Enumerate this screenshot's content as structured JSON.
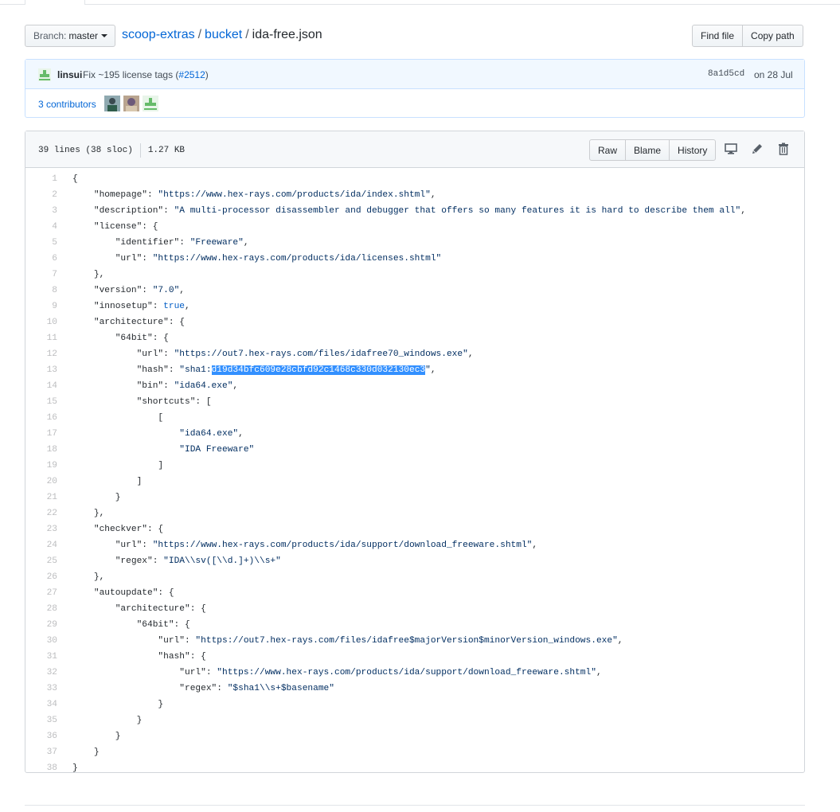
{
  "branch": {
    "prefix": "Branch:",
    "name": "master"
  },
  "breadcrumb": {
    "repo": "scoop-extras",
    "sep": "/",
    "folder": "bucket",
    "file": "ida-free.json"
  },
  "actions": {
    "find_file": "Find file",
    "copy_path": "Copy path"
  },
  "commit": {
    "author": "linsui",
    "message": "Fix ~195 license tags (",
    "pr": "#2512",
    "message_end": ")",
    "sha": "8a1d5cd",
    "date": "on 28 Jul"
  },
  "contributors": {
    "label": "3 contributors",
    "count": 3
  },
  "file": {
    "lines": "39 lines (38 sloc)",
    "size": "1.27 KB",
    "buttons": {
      "raw": "Raw",
      "blame": "Blame",
      "history": "History"
    },
    "icons": [
      "desktop-icon",
      "pencil-icon",
      "trash-icon"
    ]
  },
  "code": [
    "{",
    "    \"homepage\": \"https://www.hex-rays.com/products/ida/index.shtml\",",
    "    \"description\": \"A multi-processor disassembler and debugger that offers so many features it is hard to describe them all\",",
    "    \"license\": {",
    "        \"identifier\": \"Freeware\",",
    "        \"url\": \"https://www.hex-rays.com/products/ida/licenses.shtml\"",
    "    },",
    "    \"version\": \"7.0\",",
    "    \"innosetup\": true,",
    "    \"architecture\": {",
    "        \"64bit\": {",
    "            \"url\": \"https://out7.hex-rays.com/files/idafree70_windows.exe\",",
    "            \"hash\": \"sha1:d19d34bfc609e28cbfd92c1468c330d032130ec3\",",
    "            \"bin\": \"ida64.exe\",",
    "            \"shortcuts\": [",
    "                [",
    "                    \"ida64.exe\",",
    "                    \"IDA Freeware\"",
    "                ]",
    "            ]",
    "        }",
    "    },",
    "    \"checkver\": {",
    "        \"url\": \"https://www.hex-rays.com/products/ida/support/download_freeware.shtml\",",
    "        \"regex\": \"IDA\\\\sv([\\\\d.]+)\\\\s+\"",
    "    },",
    "    \"autoupdate\": {",
    "        \"architecture\": {",
    "            \"64bit\": {",
    "                \"url\": \"https://out7.hex-rays.com/files/idafree$majorVersion$minorVersion_windows.exe\",",
    "                \"hash\": {",
    "                    \"url\": \"https://www.hex-rays.com/products/ida/support/download_freeware.shtml\",",
    "                    \"regex\": \"$sha1\\\\s+$basename\"",
    "                }",
    "            }",
    "        }",
    "    }",
    "}"
  ],
  "selection": {
    "line": 13,
    "text": "d19d34bfc609e28cbfd92c1468c330d032130ec3"
  }
}
